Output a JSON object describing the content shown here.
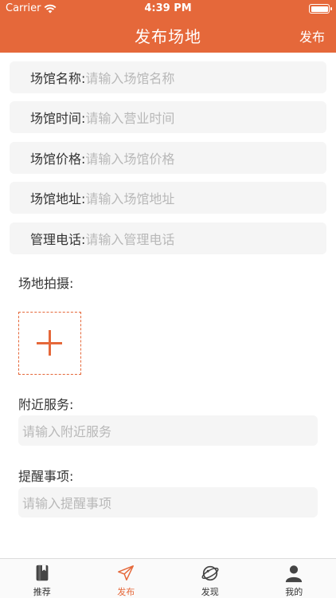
{
  "status_bar": {
    "carrier": "Carrier",
    "time": "4:39 PM"
  },
  "nav": {
    "title": "发布场地",
    "action": "发布"
  },
  "fields": [
    {
      "label": "场馆名称:",
      "placeholder": "请输入场馆名称"
    },
    {
      "label": "场馆时间:",
      "placeholder": "请输入营业时间"
    },
    {
      "label": "场馆价格:",
      "placeholder": "请输入场馆价格"
    },
    {
      "label": "场馆地址:",
      "placeholder": "请输入场馆地址"
    },
    {
      "label": "管理电话:",
      "placeholder": "请输入管理电话"
    }
  ],
  "photo": {
    "label": "场地拍摄:"
  },
  "services": {
    "label": "附近服务:",
    "placeholder": "请输入附近服务"
  },
  "reminders": {
    "label": "提醒事项:",
    "placeholder": "请输入提醒事项"
  },
  "tabs": [
    {
      "label": "推荐",
      "icon": "book-icon",
      "active": false
    },
    {
      "label": "发布",
      "icon": "paper-plane-icon",
      "active": true
    },
    {
      "label": "发现",
      "icon": "planet-icon",
      "active": false
    },
    {
      "label": "我的",
      "icon": "person-icon",
      "active": false
    }
  ],
  "colors": {
    "accent": "#e5683a",
    "field_bg": "#f5f5f5",
    "placeholder": "#b8b8b8"
  }
}
